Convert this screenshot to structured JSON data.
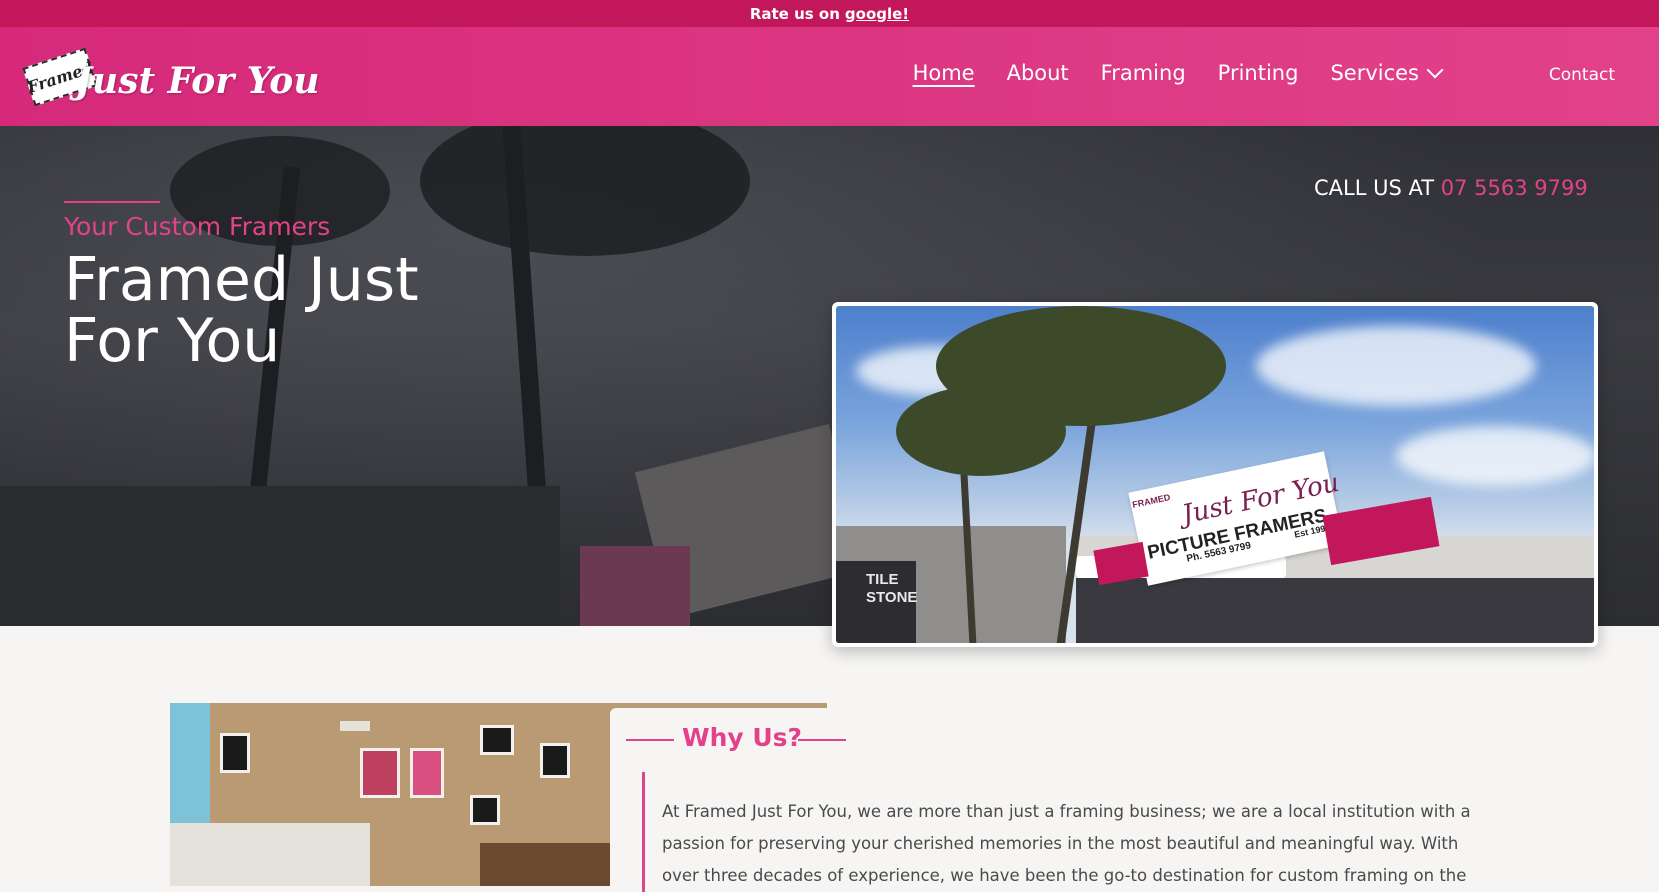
{
  "topbar": {
    "text": "Rate us on",
    "link": "google!"
  },
  "brand": {
    "tag": "Framed",
    "name": "Just For You"
  },
  "nav": {
    "items": [
      {
        "label": "Home",
        "active": true
      },
      {
        "label": "About"
      },
      {
        "label": "Framing"
      },
      {
        "label": "Printing"
      },
      {
        "label": "Services",
        "has_dropdown": true
      }
    ],
    "contact": "Contact"
  },
  "hero": {
    "subtitle": "Your Custom Framers",
    "title": "Framed Just For You",
    "call_prefix": "CALL US AT",
    "phone": "07 5563 9799"
  },
  "storefront": {
    "sign_script": "Just For You",
    "sign_main": "PICTURE FRAMERS",
    "sign_phone": "Ph. 5563 9799",
    "sign_est": "Est 1997",
    "sign_corner": "FRAMED",
    "tile_sign": "TILE STONE"
  },
  "why": {
    "title": "Why Us?",
    "text": "At Framed Just For You, we are more than just a framing business; we are a local institution with a passion for preserving your cherished memories in the most beautiful and meaningful way. With over three decades of experience, we have been the go-to destination for custom framing on the"
  },
  "colors": {
    "brand_pink": "#e2428a",
    "topbar": "#c2185b"
  }
}
